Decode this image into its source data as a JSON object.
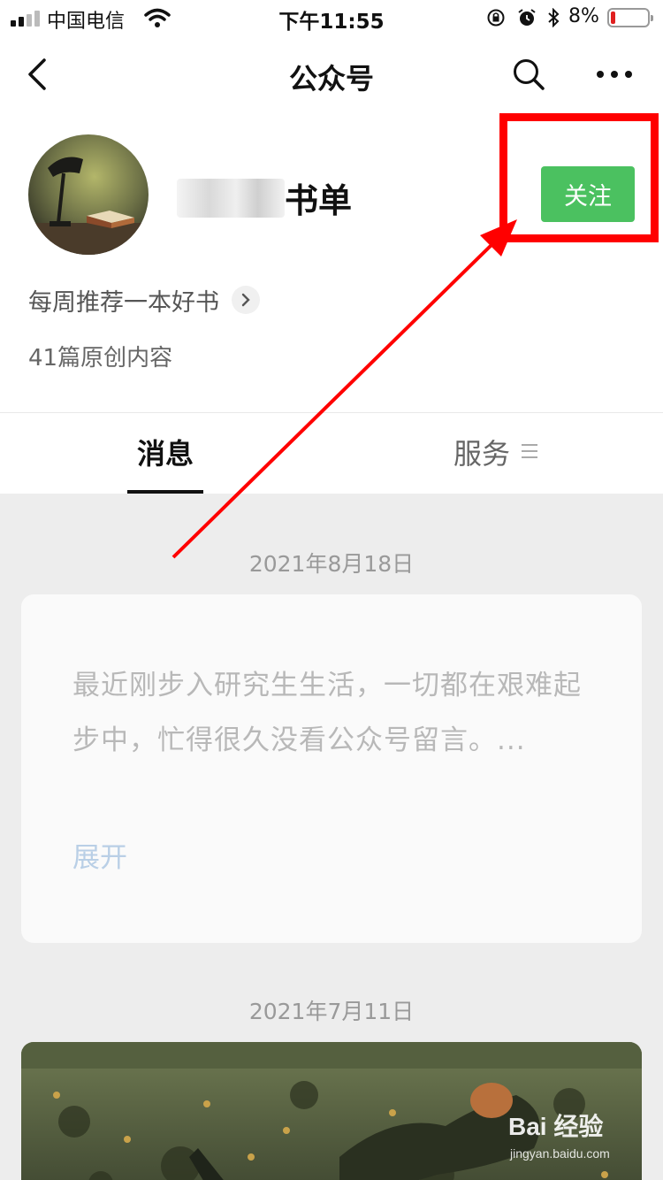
{
  "status_bar": {
    "carrier": "中国电信",
    "time": "下午11:55",
    "battery_percent": "8%",
    "battery_level": 0.08,
    "icons": [
      "signal-icon",
      "wifi-icon",
      "orientation-lock-icon",
      "alarm-icon",
      "bluetooth-icon",
      "battery-icon"
    ]
  },
  "nav": {
    "title": "公众号",
    "back_icon": "chevron-left-icon",
    "search_icon": "search-icon",
    "more_icon": "more-icon"
  },
  "account": {
    "name_visible": "书单",
    "follow_label": "关注",
    "description": "每周推荐一本好书",
    "original_count": "41篇原创内容",
    "follow_color": "#4bc160"
  },
  "tabs": [
    {
      "label": "消息",
      "active": true
    },
    {
      "label": "服务",
      "active": false
    }
  ],
  "feed": {
    "items": [
      {
        "date": "2021年8月18日",
        "text": "最近刚步入研究生生活，一切都在艰难起步中，忙得很久没看公众号留言。...",
        "expand_label": "展开"
      },
      {
        "date": "2021年7月11日"
      }
    ]
  },
  "annotation": {
    "color": "#ff0000"
  },
  "watermark": {
    "brand": "Bai 经验",
    "url": "jingyan.baidu.com"
  }
}
